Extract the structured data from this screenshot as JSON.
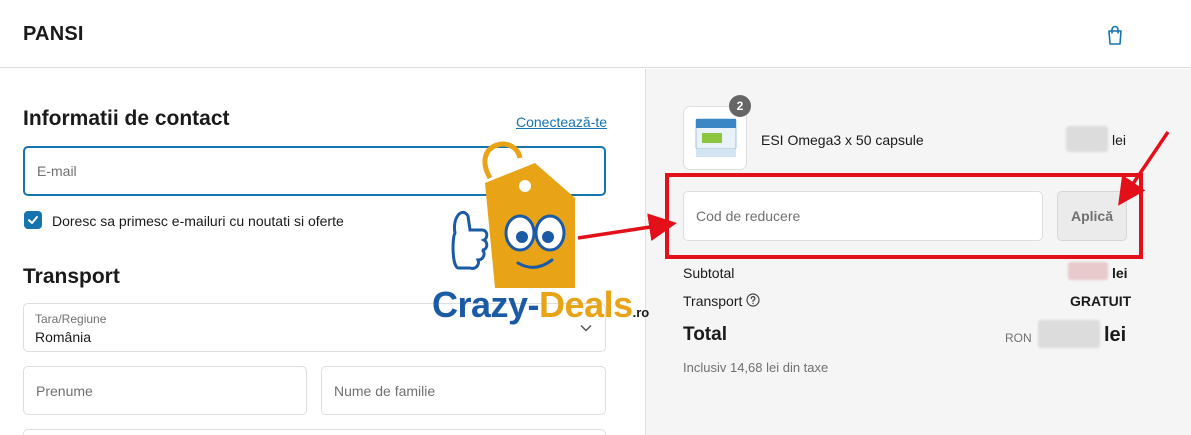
{
  "header": {
    "brand": "PANSI",
    "cart_icon": "shopping-bag-icon"
  },
  "contact": {
    "title": "Informatii de contact",
    "login_link": "Conectează-te",
    "email_placeholder": "E-mail",
    "newsletter_label": "Doresc sa primesc e-mailuri cu noutati si oferte",
    "newsletter_checked": true
  },
  "transport_section": {
    "title": "Transport",
    "country_label": "Tara/Regiune",
    "country_value": "România",
    "first_name_placeholder": "Prenume",
    "last_name_placeholder": "Nume de familie"
  },
  "order_summary": {
    "product": {
      "name": "ESI Omega3 x 50 capsule",
      "quantity": "2",
      "price_unit": "lei"
    },
    "discount": {
      "placeholder": "Cod de reducere",
      "apply_label": "Aplică"
    },
    "subtotal_label": "Subtotal",
    "subtotal_unit": "lei",
    "transport_label": "Transport",
    "transport_value": "GRATUIT",
    "total_label": "Total",
    "currency": "RON",
    "total_unit": "lei",
    "tax_note": "Inclusiv 14,68 lei din taxe"
  },
  "watermark": {
    "logo_part1": "Crazy-",
    "logo_part2": "Deals",
    "logo_tld": ".ro"
  },
  "colors": {
    "accent": "#1773b0",
    "annotation": "#e3101a",
    "logo_blue": "#1b5aa5",
    "logo_orange": "#e8a317"
  }
}
